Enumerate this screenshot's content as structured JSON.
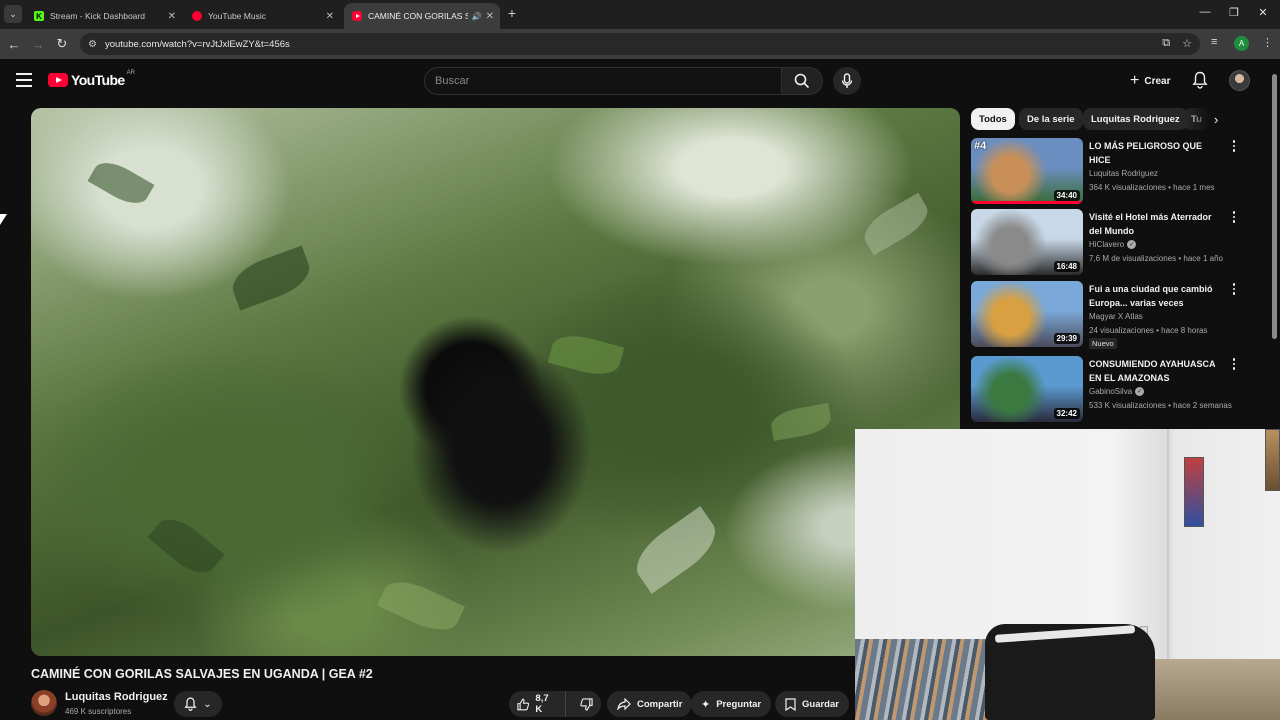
{
  "browser": {
    "tabs": [
      {
        "title": "Stream - Kick Dashboard",
        "favicon": "kick-icon"
      },
      {
        "title": "YouTube Music",
        "favicon": "youtube-music-icon"
      },
      {
        "title": "CAMINÉ CON GORILAS SAL",
        "favicon": "youtube-icon",
        "active": true,
        "audio": true
      }
    ],
    "url": "youtube.com/watch?v=rvJtJxlEwZY&t=456s",
    "profile_initial": "A"
  },
  "header": {
    "logo_text": "YouTube",
    "country_code": "AR",
    "search_placeholder": "Buscar",
    "create_label": "Crear"
  },
  "video": {
    "title": "CAMINÉ CON GORILAS SALVAJES EN UGANDA | GEA #2",
    "channel": "Luquitas Rodriguez",
    "subscribers": "469 K suscriptores",
    "likes": "8,7 K",
    "share_label": "Compartir",
    "ask_label": "Preguntar",
    "save_label": "Guardar"
  },
  "chips": [
    "Todos",
    "De la serie",
    "Luquitas Rodriguez",
    "Tu"
  ],
  "recommendations": [
    {
      "title": "LO MÁS PELIGROSO QUE HICE\nEN MI VIDA - SAFARI EN KENI...",
      "channel": "Luquitas Rodriguez",
      "verified": false,
      "meta": "364 K visualizaciones • hace 1 mes",
      "duration": "34:40",
      "badge": "",
      "overlay": "#4",
      "thumb_colors": [
        "#6a8ec0",
        "#c89058",
        "#3a6a30"
      ],
      "watched": 1
    },
    {
      "title": "Visité el Hotel más Aterrador\ndel Mundo",
      "channel": "HiClavero",
      "verified": true,
      "meta": "7,6 M de visualizaciones • hace 1 año",
      "duration": "16:48",
      "badge": "",
      "overlay": "",
      "thumb_colors": [
        "#c8d8e8",
        "#8a8a8a",
        "#2a2a2a"
      ],
      "watched": 0
    },
    {
      "title": "Fui a una ciudad que cambió\nEuropa... varias veces",
      "channel": "Magyar X Atlas",
      "verified": false,
      "meta": "24 visualizaciones • hace 8 horas",
      "duration": "29:39",
      "badge": "Nuevo",
      "overlay": "",
      "thumb_colors": [
        "#7aa8d8",
        "#d8a040",
        "#4a4a5a"
      ],
      "watched": 0
    },
    {
      "title": "CONSUMIENDO AYAHUASCA\nEN EL AMAZONAS",
      "channel": "GabinoSilva",
      "verified": true,
      "meta": "533 K visualizaciones • hace 2 semanas",
      "duration": "32:42",
      "badge": "",
      "overlay": "",
      "thumb_colors": [
        "#5a9ad0",
        "#3a7a40",
        "#2a2a3a"
      ],
      "watched": 0
    }
  ]
}
